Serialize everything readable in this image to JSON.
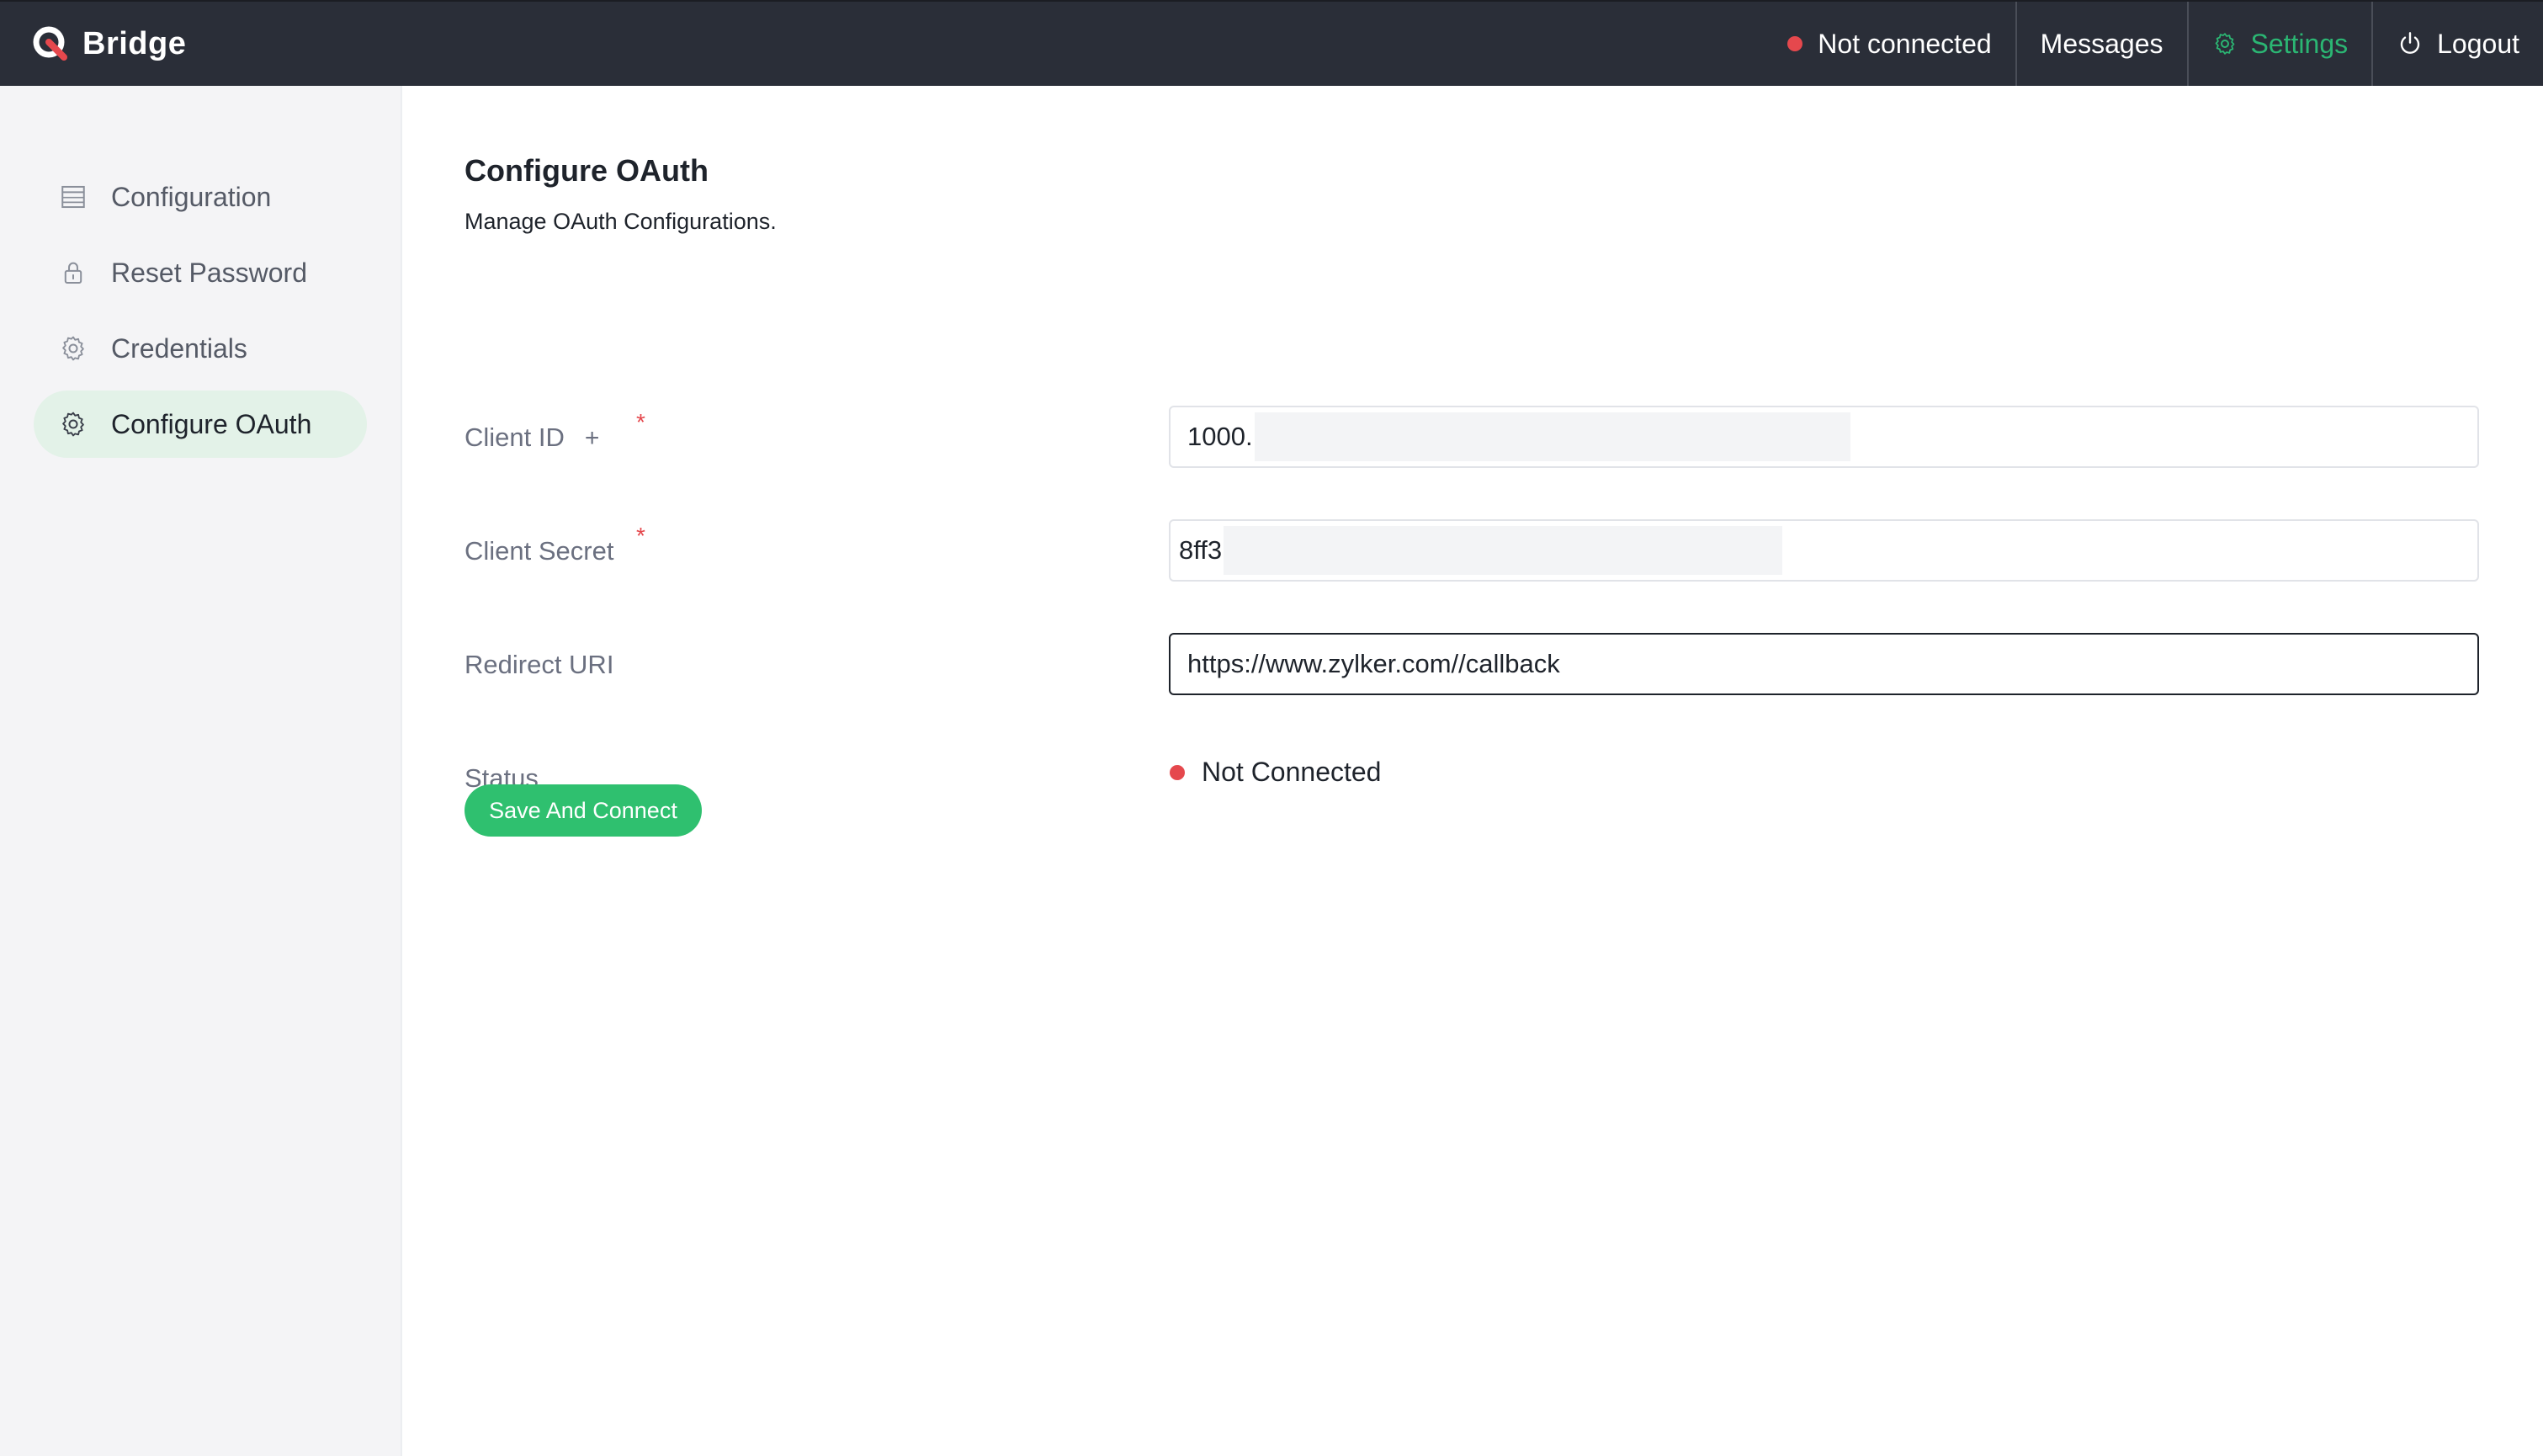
{
  "header": {
    "brand": "Bridge",
    "connection_status": "Not connected",
    "messages": "Messages",
    "settings": "Settings",
    "logout": "Logout",
    "status_color": "#e5484d",
    "accent_color": "#2bb673"
  },
  "sidebar": {
    "items": [
      {
        "label": "Configuration",
        "icon": "table-icon",
        "active": false
      },
      {
        "label": "Reset Password",
        "icon": "lock-icon",
        "active": false
      },
      {
        "label": "Credentials",
        "icon": "gear-icon",
        "active": false
      },
      {
        "label": "Configure OAuth",
        "icon": "gear-icon",
        "active": true
      }
    ]
  },
  "main": {
    "title": "Configure OAuth",
    "subtitle": "Manage OAuth Configurations.",
    "form": {
      "client_id": {
        "label": "Client ID",
        "plus": "+",
        "required_mark": "*",
        "value": "1000."
      },
      "client_secret": {
        "label": "Client Secret",
        "required_mark": "*",
        "value": "8ff3"
      },
      "redirect_uri": {
        "label": "Redirect URI",
        "value": "https://www.zylker.com//callback"
      },
      "status": {
        "label": "Status",
        "value": "Not Connected"
      }
    },
    "save_button": "Save And Connect"
  }
}
